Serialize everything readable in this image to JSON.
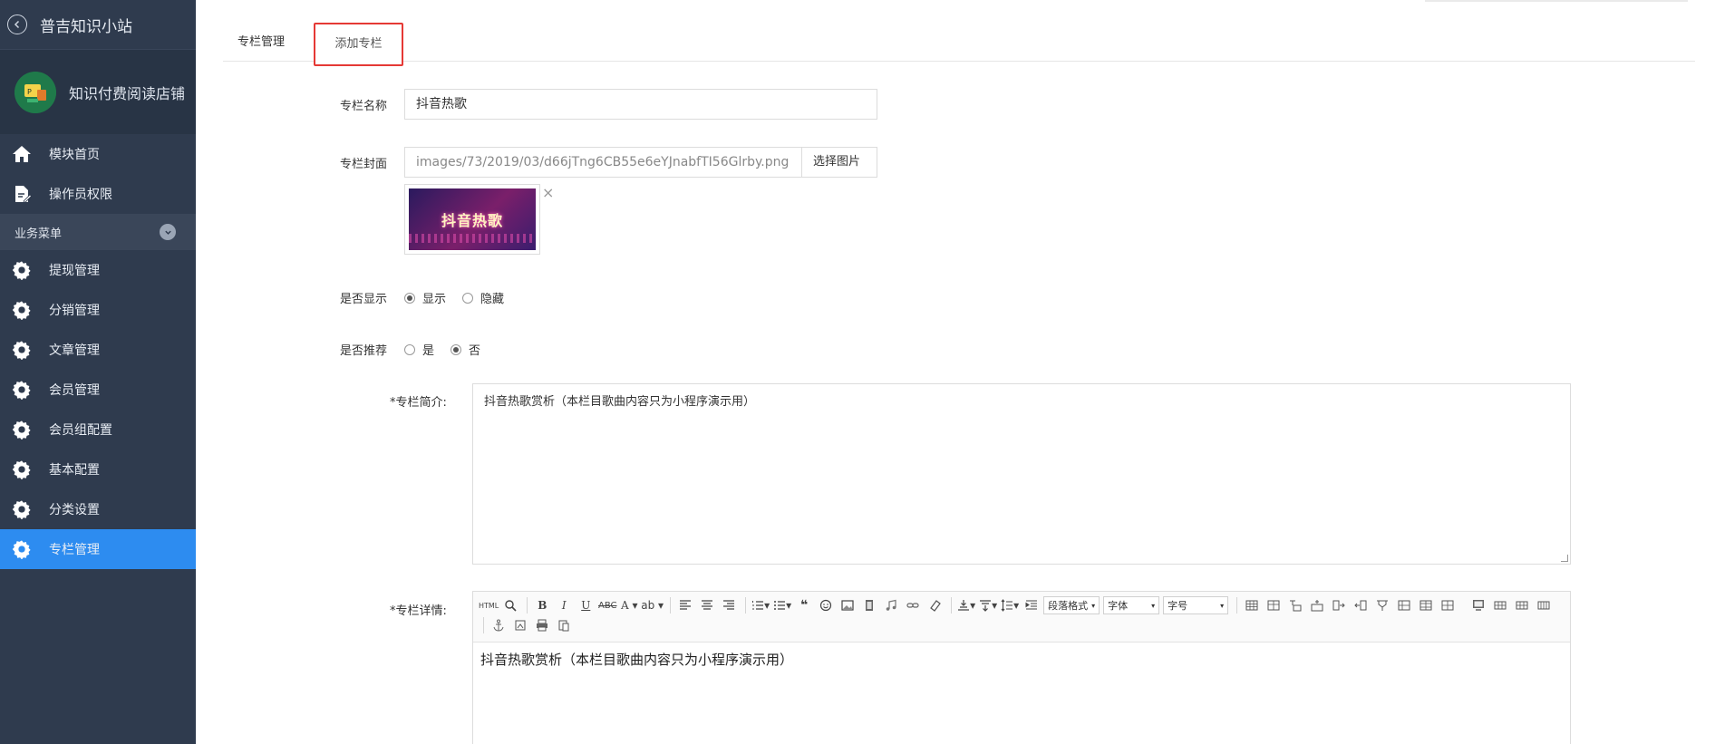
{
  "sidebar": {
    "title": "普吉知识小站",
    "shop_name": "知识付费阅读店铺",
    "top_items": [
      {
        "label": "模块首页",
        "icon": "home-icon"
      },
      {
        "label": "操作员权限",
        "icon": "document-edit-icon"
      }
    ],
    "group_label": "业务菜单",
    "items": [
      {
        "label": "提现管理",
        "icon": "gear-icon"
      },
      {
        "label": "分销管理",
        "icon": "gear-icon"
      },
      {
        "label": "文章管理",
        "icon": "gear-icon"
      },
      {
        "label": "会员管理",
        "icon": "gear-icon"
      },
      {
        "label": "会员组配置",
        "icon": "gear-icon"
      },
      {
        "label": "基本配置",
        "icon": "gear-icon"
      },
      {
        "label": "分类设置",
        "icon": "gear-icon"
      },
      {
        "label": "专栏管理",
        "icon": "gear-icon",
        "active": true
      }
    ]
  },
  "tabs": [
    {
      "label": "专栏管理"
    },
    {
      "label": "添加专栏",
      "highlighted": true
    }
  ],
  "form": {
    "name_label": "专栏名称",
    "name_value": "抖音热歌",
    "cover_label": "专栏封面",
    "cover_value": "images/73/2019/03/d66jTng6CB55e6eYJnabfTI56Glrby.png",
    "cover_button": "选择图片",
    "cover_image_text": "抖音热歌",
    "cover_remove": "×",
    "show_label": "是否显示",
    "show_options": [
      "显示",
      "隐藏"
    ],
    "show_selected": "显示",
    "recommend_label": "是否推荐",
    "recommend_options": [
      "是",
      "否"
    ],
    "recommend_selected": "否",
    "intro_label": "*专栏简介:",
    "intro_value": "抖音热歌赏析（本栏目歌曲内容只为小程序演示用）",
    "detail_label": "*专栏详情:",
    "detail_value": "抖音热歌赏析（本栏目歌曲内容只为小程序演示用）"
  },
  "editor": {
    "html_btn": "HTML",
    "paragraph_select": "段落格式",
    "font_select": "字体",
    "size_select": "字号"
  },
  "colors": {
    "sidebar_bg": "#2f3b4e",
    "active_item": "#2d8cf0",
    "tab_highlight_border": "#e53935"
  }
}
